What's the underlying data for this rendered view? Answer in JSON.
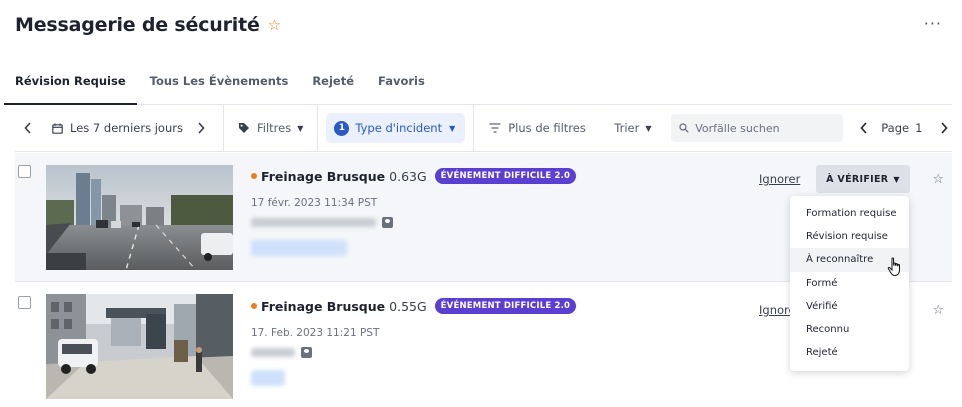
{
  "header": {
    "title": "Messagerie de sécurité",
    "more": "···"
  },
  "tabs": [
    {
      "label": "Révision Requise",
      "active": true
    },
    {
      "label": "Tous Les Évènements"
    },
    {
      "label": "Rejeté"
    },
    {
      "label": "Favoris"
    }
  ],
  "toolbar": {
    "date_range": "Les 7 derniers jours",
    "filters": "Filtres",
    "incident_count": "1",
    "incident_type": "Type d'incident",
    "more_filters": "Plus de filtres",
    "sort": "Trier",
    "search_placeholder": "Vorfälle suchen",
    "page_label": "Page",
    "page_number": "1"
  },
  "events": [
    {
      "name": "Freinage Brusque",
      "gforce": "0.63G",
      "badge": "ÉVÉNEMENT DIFFICILE 2.0",
      "timestamp": "17 févr. 2023 11:34 PST",
      "ignore": "Ignorer",
      "status": "À VÉRIFIER"
    },
    {
      "name": "Freinage Brusque",
      "gforce": "0.55G",
      "badge": "ÉVÉNEMENT DIFFICILE 2.0",
      "timestamp": "17. Feb. 2023 11:21 PST",
      "ignore": "Ignorer"
    }
  ],
  "status_menu": [
    "Formation requise",
    "Révision requise",
    "À reconnaître",
    "Formé",
    "Vérifié",
    "Reconnu",
    "Rejeté"
  ],
  "colors": {
    "accent": "#2a58c5",
    "hard_badge": "#5b3fd1",
    "severity_dot": "#e8811d"
  }
}
